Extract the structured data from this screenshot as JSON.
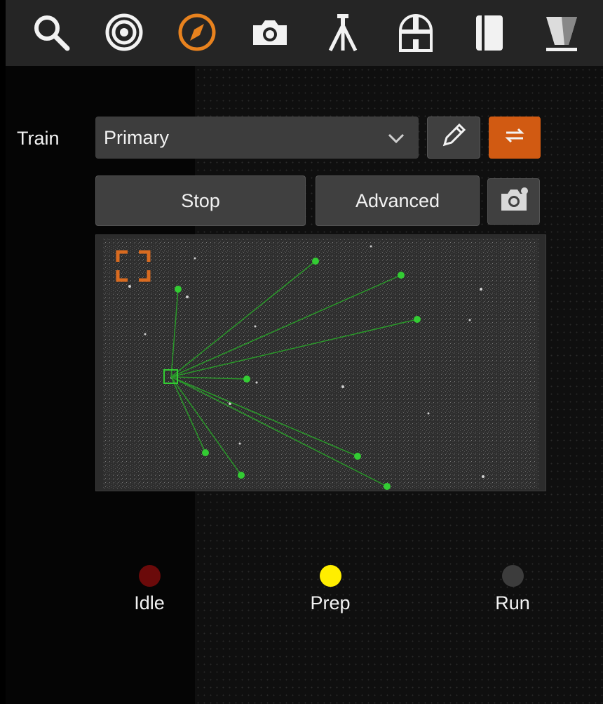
{
  "toolbar": {
    "icons": [
      {
        "name": "search-icon",
        "active": false
      },
      {
        "name": "target-icon",
        "active": false
      },
      {
        "name": "compass-icon",
        "active": true
      },
      {
        "name": "camera-icon",
        "active": false
      },
      {
        "name": "tripod-icon",
        "active": false
      },
      {
        "name": "observatory-dome-icon",
        "active": false
      },
      {
        "name": "notebook-icon",
        "active": false
      },
      {
        "name": "filter-icon",
        "active": false
      }
    ],
    "active_color": "#e8821e",
    "icon_color": "#f2f2f2"
  },
  "train": {
    "label": "Train",
    "selected": "Primary"
  },
  "actions": {
    "stop_label": "Stop",
    "advanced_label": "Advanced"
  },
  "statuses": [
    {
      "label": "Idle",
      "color": "#6b0a0a"
    },
    {
      "label": "Prep",
      "color": "#ffee00"
    },
    {
      "label": "Run",
      "color": "#3c3c3c"
    }
  ],
  "colors": {
    "accent": "#d15a12",
    "guide_star": "#22cc22"
  }
}
